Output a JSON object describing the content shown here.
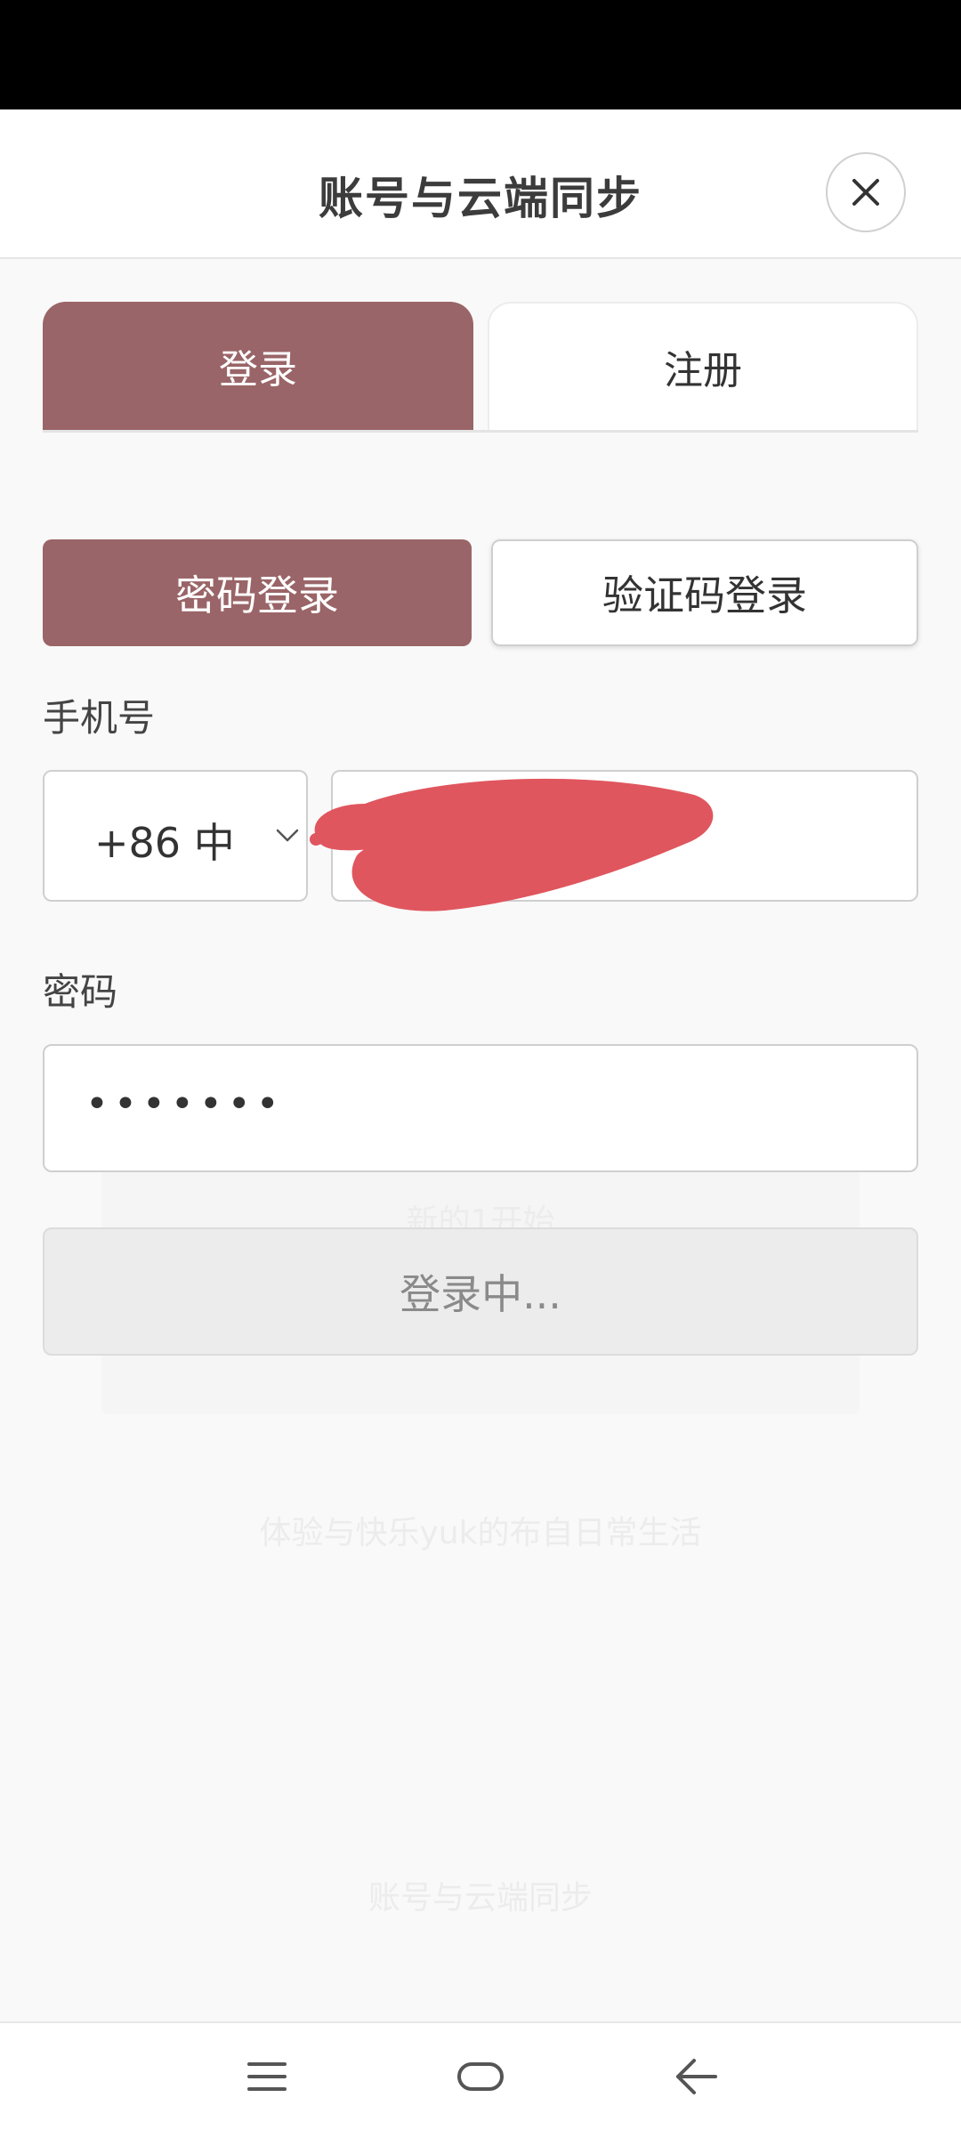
{
  "sheet": {
    "title": "账号与云端同步",
    "close_icon": "close-icon"
  },
  "tabs": {
    "login": "登录",
    "register": "注册"
  },
  "login_methods": {
    "password": "密码登录",
    "code": "验证码登录"
  },
  "phone": {
    "label": "手机号",
    "country_code": "+86 中",
    "value": ""
  },
  "password": {
    "label": "密码",
    "value": "•••••••"
  },
  "login_button": "登录中...",
  "background_faint": {
    "line1": "新的1开始",
    "line2": "体验与快乐yuk的布自日常生活",
    "line3": "账号与云端同步"
  },
  "colors": {
    "accent": "#9a6568",
    "redaction": "#e0565e"
  },
  "nav": {
    "menu_icon": "menu-icon",
    "home_icon": "home-icon",
    "back_icon": "back-icon"
  }
}
